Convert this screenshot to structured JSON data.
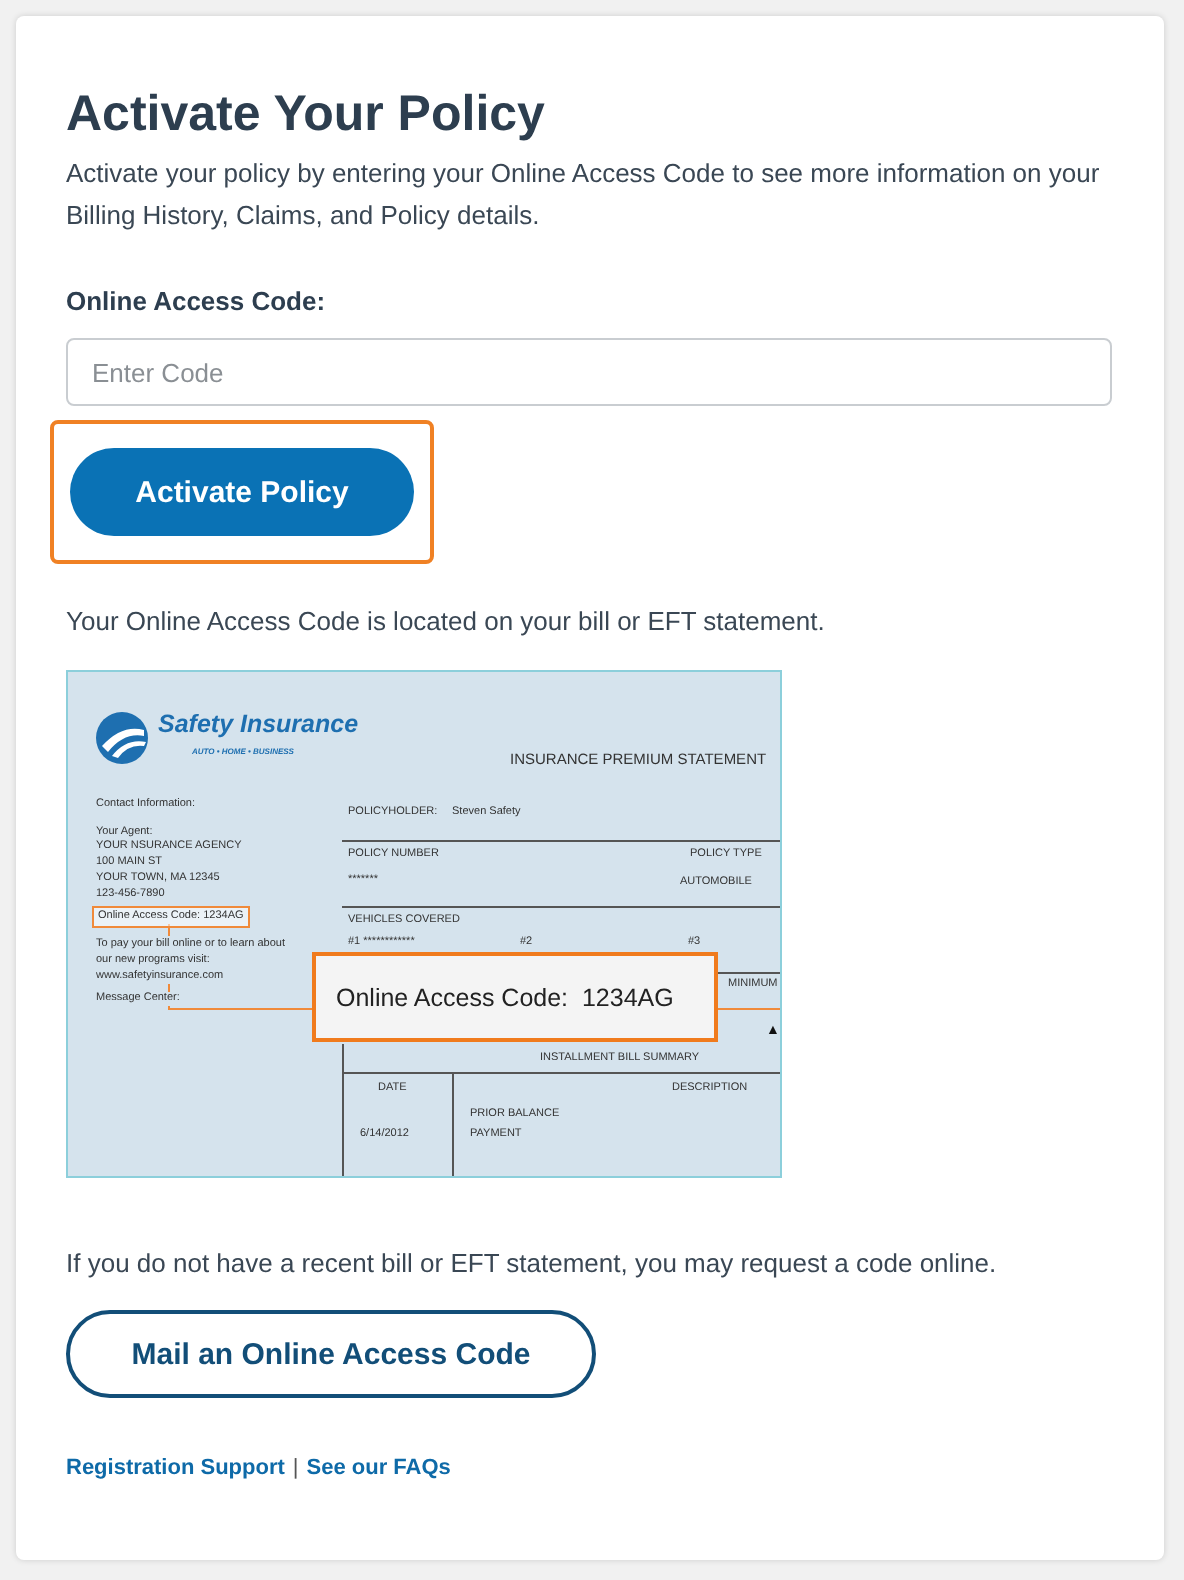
{
  "title": "Activate Your Policy",
  "intro": "Activate your policy by entering your Online Access Code to see more information on your Billing History, Claims, and Policy details.",
  "code_field": {
    "label": "Online Access Code:",
    "placeholder": "Enter Code"
  },
  "activate_button": {
    "label": "Activate Policy",
    "focused": true
  },
  "location_note": "Your Online Access Code is located on your bill or EFT statement.",
  "bill": {
    "brand": "Safety Insurance",
    "tagline": "AUTO • HOME • BUSINESS",
    "heading": "INSURANCE PREMIUM STATEMENT",
    "contact_label": "Contact Information:",
    "agent_label": "Your Agent:",
    "agent_lines": [
      "YOUR NSURANCE AGENCY",
      "100 MAIN ST",
      "YOUR TOWN, MA 12345",
      "123-456-7890"
    ],
    "code_line": "Online Access Code: 1234AG",
    "pay_note": "To pay your bill online or to learn about our new programs visit: www.safetyinsurance.com",
    "message_label": "Message Center:",
    "policyholder_label": "POLICYHOLDER:",
    "policyholder": "Steven Safety",
    "policy_number_label": "POLICY NUMBER",
    "policy_number": "*******",
    "policy_type_label": "POLICY TYPE",
    "policy_type": "AUTOMOBILE",
    "vehicles_label": "VEHICLES COVERED",
    "vehicles": [
      "#1 ************",
      "#2",
      "#3"
    ],
    "minimum_label": "MINIMUM",
    "marker": "▲",
    "summary_title": "INSTALLMENT BILL SUMMARY",
    "date_label": "DATE",
    "description_label": "DESCRIPTION",
    "date": "6/14/2012",
    "descriptions": [
      "PRIOR BALANCE",
      "PAYMENT"
    ],
    "callout": "Online Access Code:  1234AG"
  },
  "request_note": "If you do not have a recent bill or EFT statement, you may request a code online.",
  "mail_button": "Mail an Online Access Code",
  "footer_links": [
    {
      "label": "Registration Support"
    },
    {
      "label": "See our FAQs"
    }
  ],
  "footer_separator": "|"
}
